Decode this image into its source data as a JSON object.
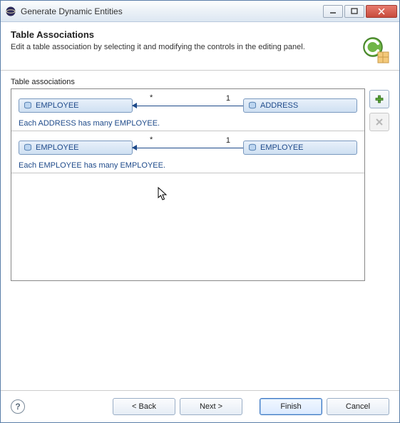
{
  "window": {
    "title": "Generate Dynamic Entities"
  },
  "header": {
    "title": "Table Associations",
    "description": "Edit a table association by selecting it and modifying the controls in the editing panel."
  },
  "section_label": "Table associations",
  "associations": [
    {
      "left_entity": "EMPLOYEE",
      "left_cardinality": "*",
      "right_cardinality": "1",
      "right_entity": "ADDRESS",
      "description": "Each ADDRESS has many EMPLOYEE."
    },
    {
      "left_entity": "EMPLOYEE",
      "left_cardinality": "*",
      "right_cardinality": "1",
      "right_entity": "EMPLOYEE",
      "description": "Each EMPLOYEE has many EMPLOYEE."
    }
  ],
  "buttons": {
    "back": "< Back",
    "next": "Next >",
    "finish": "Finish",
    "cancel": "Cancel"
  },
  "icons": {
    "add": "+",
    "remove": "✕",
    "help": "?"
  }
}
